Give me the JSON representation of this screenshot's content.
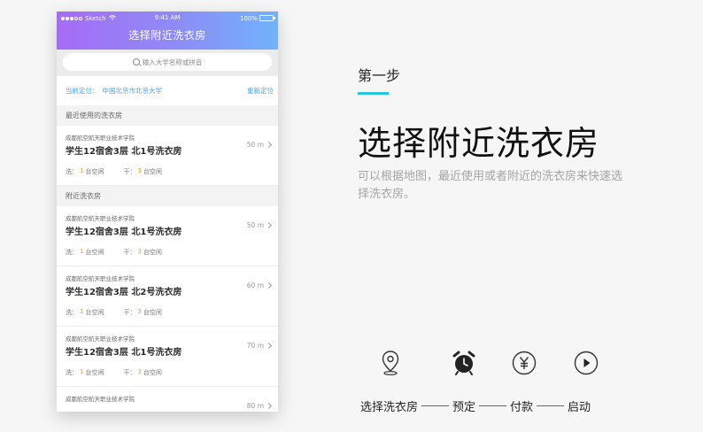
{
  "status_bar": {
    "carrier": "Sketch",
    "time": "9:41 AM",
    "battery": "100%"
  },
  "nav": {
    "title": "选择附近洗衣房"
  },
  "search": {
    "placeholder": "输入大学名称或拼音"
  },
  "location": {
    "label": "当前定位：",
    "value": "中国北京市北京大学",
    "relocate": "重新定位"
  },
  "recent": {
    "title": "最近使用的洗衣房",
    "items": [
      {
        "school": "成都航空航天职业技术学院",
        "name": "学生12宿舍3层 北1号洗衣房",
        "distance": "50 m",
        "wash_label": "洗：",
        "wash_count": "1",
        "wash_unit": "台空闲",
        "dry_label": "干：",
        "dry_count": "3",
        "dry_unit": "台空闲"
      }
    ]
  },
  "nearby": {
    "title": "附近洗衣房",
    "items": [
      {
        "school": "成都航空航天职业技术学院",
        "name": "学生12宿舍3层 北1号洗衣房",
        "distance": "50 m",
        "wash_label": "洗：",
        "wash_count": "1",
        "wash_unit": "台空闲",
        "dry_label": "干：",
        "dry_count": "3",
        "dry_unit": "台空闲"
      },
      {
        "school": "成都航空航天职业技术学院",
        "name": "学生12宿舍3层 北2号洗衣房",
        "distance": "60 m",
        "wash_label": "洗：",
        "wash_count": "1",
        "wash_unit": "台空闲",
        "dry_label": "干：",
        "dry_count": "3",
        "dry_unit": "台空闲"
      },
      {
        "school": "成都航空航天职业技术学院",
        "name": "学生12宿舍3层 北1号洗衣房",
        "distance": "70 m",
        "wash_label": "洗：",
        "wash_count": "1",
        "wash_unit": "台空闲",
        "dry_label": "干：",
        "dry_count": "3",
        "dry_unit": "台空闲"
      },
      {
        "school": "成都航空航天职业技术学院",
        "name": "",
        "distance": "80 m",
        "wash_label": "",
        "wash_count": "",
        "wash_unit": "",
        "dry_label": "",
        "dry_count": "",
        "dry_unit": ""
      }
    ]
  },
  "step": {
    "label": "第一步",
    "title": "选择附近洗衣房",
    "description": "可以根据地图，最近使用或者附近的洗衣房来快速选择洗衣房。"
  },
  "flow": {
    "steps": [
      "选择洗衣房",
      "预定",
      "付款",
      "启动"
    ],
    "icons": [
      "location-pin-icon",
      "alarm-clock-icon",
      "yen-coin-icon",
      "play-circle-icon"
    ]
  },
  "colors": {
    "accent": "#27c6dd",
    "link": "#46a6f0",
    "count": "#f2a12d",
    "gradient_start": "#a66cf5",
    "gradient_end": "#71b3fb"
  }
}
